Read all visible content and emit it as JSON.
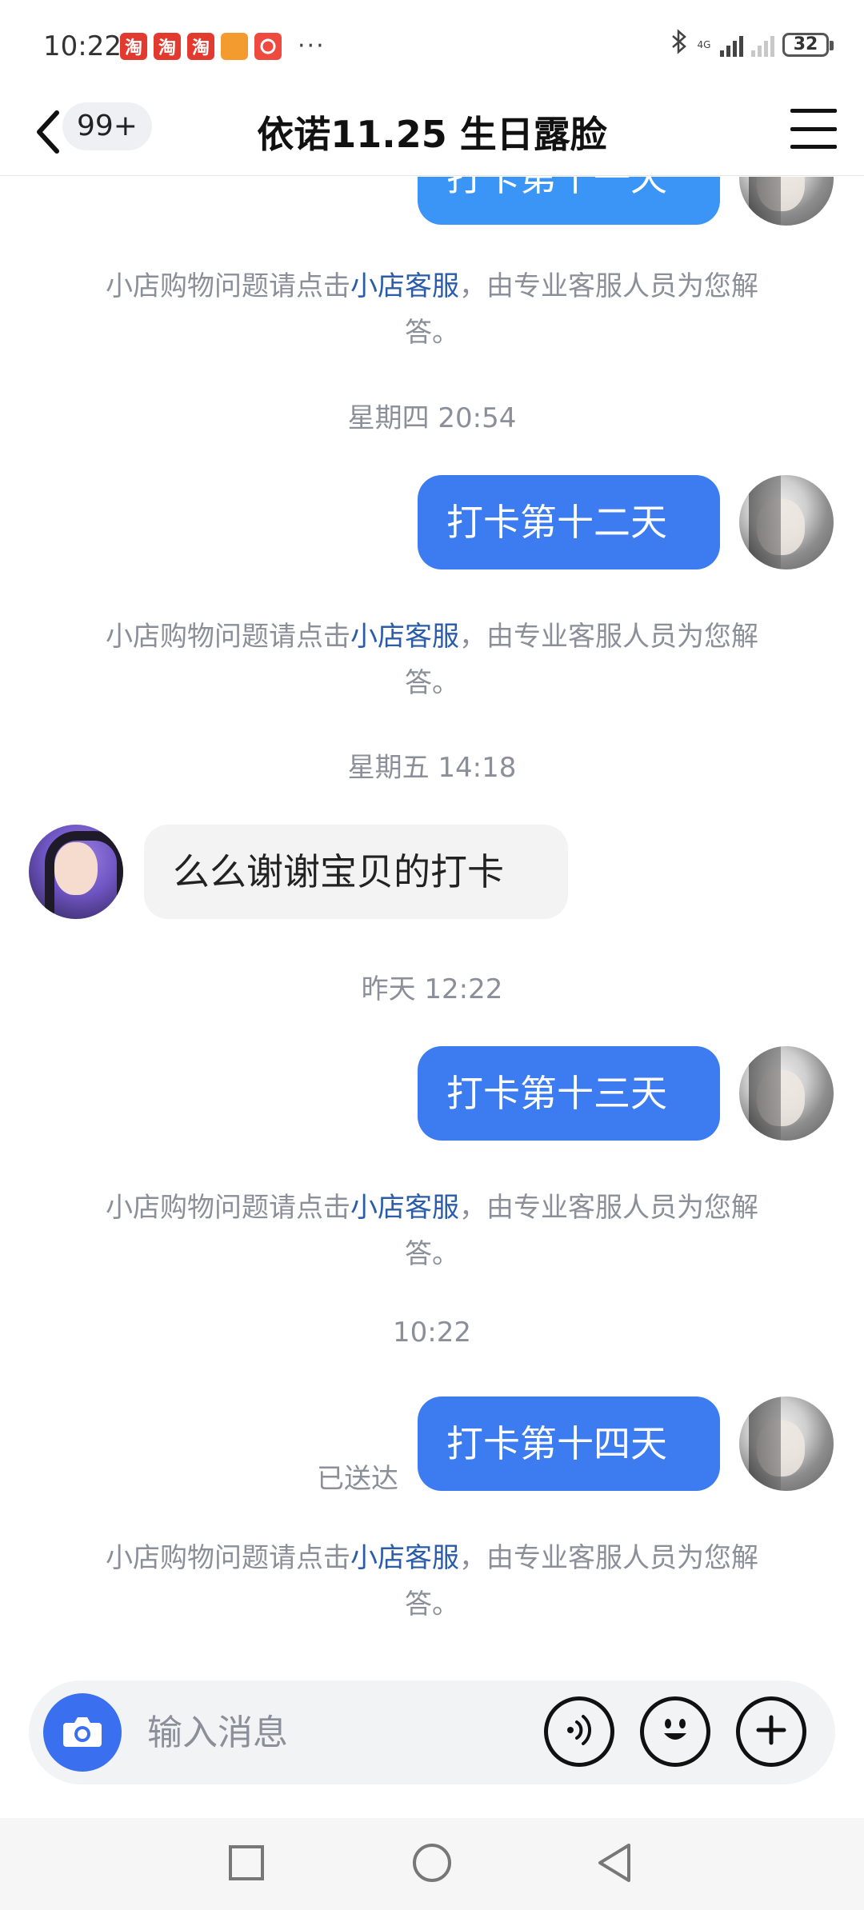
{
  "status_bar": {
    "time": "10:22",
    "apps": [
      {
        "name": "taobao-icon",
        "glyph": "淘",
        "color": "#e33a2f"
      },
      {
        "name": "taobao-icon",
        "glyph": "淘",
        "color": "#e33a2f"
      },
      {
        "name": "taobao-icon",
        "glyph": "淘",
        "color": "#e33a2f"
      },
      {
        "name": "shop-app-icon",
        "glyph": "",
        "color": "#f39b2f"
      },
      {
        "name": "pinduoduo-icon",
        "glyph": "",
        "color": "#ef4a3f"
      }
    ],
    "more": "···",
    "network_label": "4G",
    "battery": "32"
  },
  "header": {
    "back_icon": "chevron-left-icon",
    "unread_count": "99+",
    "title": "依诺11.25 生日露脸",
    "menu_icon": "hamburger-menu-icon"
  },
  "messages": {
    "top_bubble_text": "打卡第十一天",
    "notice_prefix": "小店购物问题请点击",
    "notice_link": "小店客服",
    "notice_suffix": "，由专业客服人员为您解答。",
    "timestamps": [
      "星期四 20:54",
      "星期五 14:18",
      "昨天 12:22",
      "10:22"
    ],
    "self_bubbles": [
      "打卡第十二天",
      "打卡第十三天",
      "打卡第十四天"
    ],
    "other_bubble": "么么谢谢宝贝的打卡",
    "delivered": "已送达"
  },
  "input_bar": {
    "placeholder": "输入消息",
    "camera_icon": "camera-icon",
    "voice_icon": "voice-icon",
    "emoji_icon": "emoji-icon",
    "plus_icon": "plus-icon"
  },
  "colors": {
    "bubble_self": "#3c7bf0",
    "bubble_other": "#f3f3f3",
    "link": "#2a5caa",
    "muted_text": "#8a8f99"
  }
}
